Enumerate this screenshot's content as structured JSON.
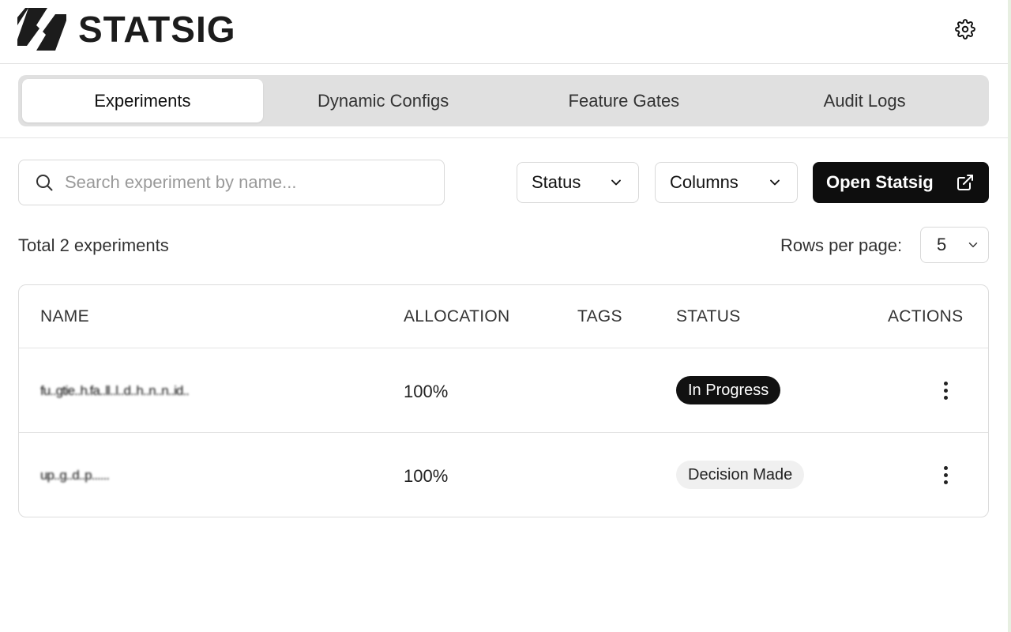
{
  "brand": {
    "name": "STATSIG"
  },
  "header": {
    "settings_icon": "gear-icon"
  },
  "tabs": [
    {
      "label": "Experiments",
      "active": true
    },
    {
      "label": "Dynamic Configs",
      "active": false
    },
    {
      "label": "Feature Gates",
      "active": false
    },
    {
      "label": "Audit Logs",
      "active": false
    }
  ],
  "toolbar": {
    "search_placeholder": "Search experiment by name...",
    "search_value": "",
    "status_label": "Status",
    "columns_label": "Columns",
    "open_label": "Open Statsig"
  },
  "summary": {
    "total_text": "Total 2 experiments"
  },
  "pagination": {
    "rows_label": "Rows per page:",
    "rows_value": "5"
  },
  "table": {
    "columns": [
      "NAME",
      "ALLOCATION",
      "TAGS",
      "STATUS",
      "ACTIONS"
    ],
    "rows": [
      {
        "name": "fu..gtie..h.fa..ll..l..d..h..n..n..id..",
        "allocation": "100%",
        "tags": "",
        "status": "In Progress",
        "status_style": "dark"
      },
      {
        "name": "up..g..d..p......",
        "allocation": "100%",
        "tags": "",
        "status": "Decision Made",
        "status_style": "light"
      }
    ]
  },
  "colors": {
    "primary": "#0e0e0e",
    "tab_bg": "#e0e0e0",
    "badge_light": "#f0f0f0"
  }
}
